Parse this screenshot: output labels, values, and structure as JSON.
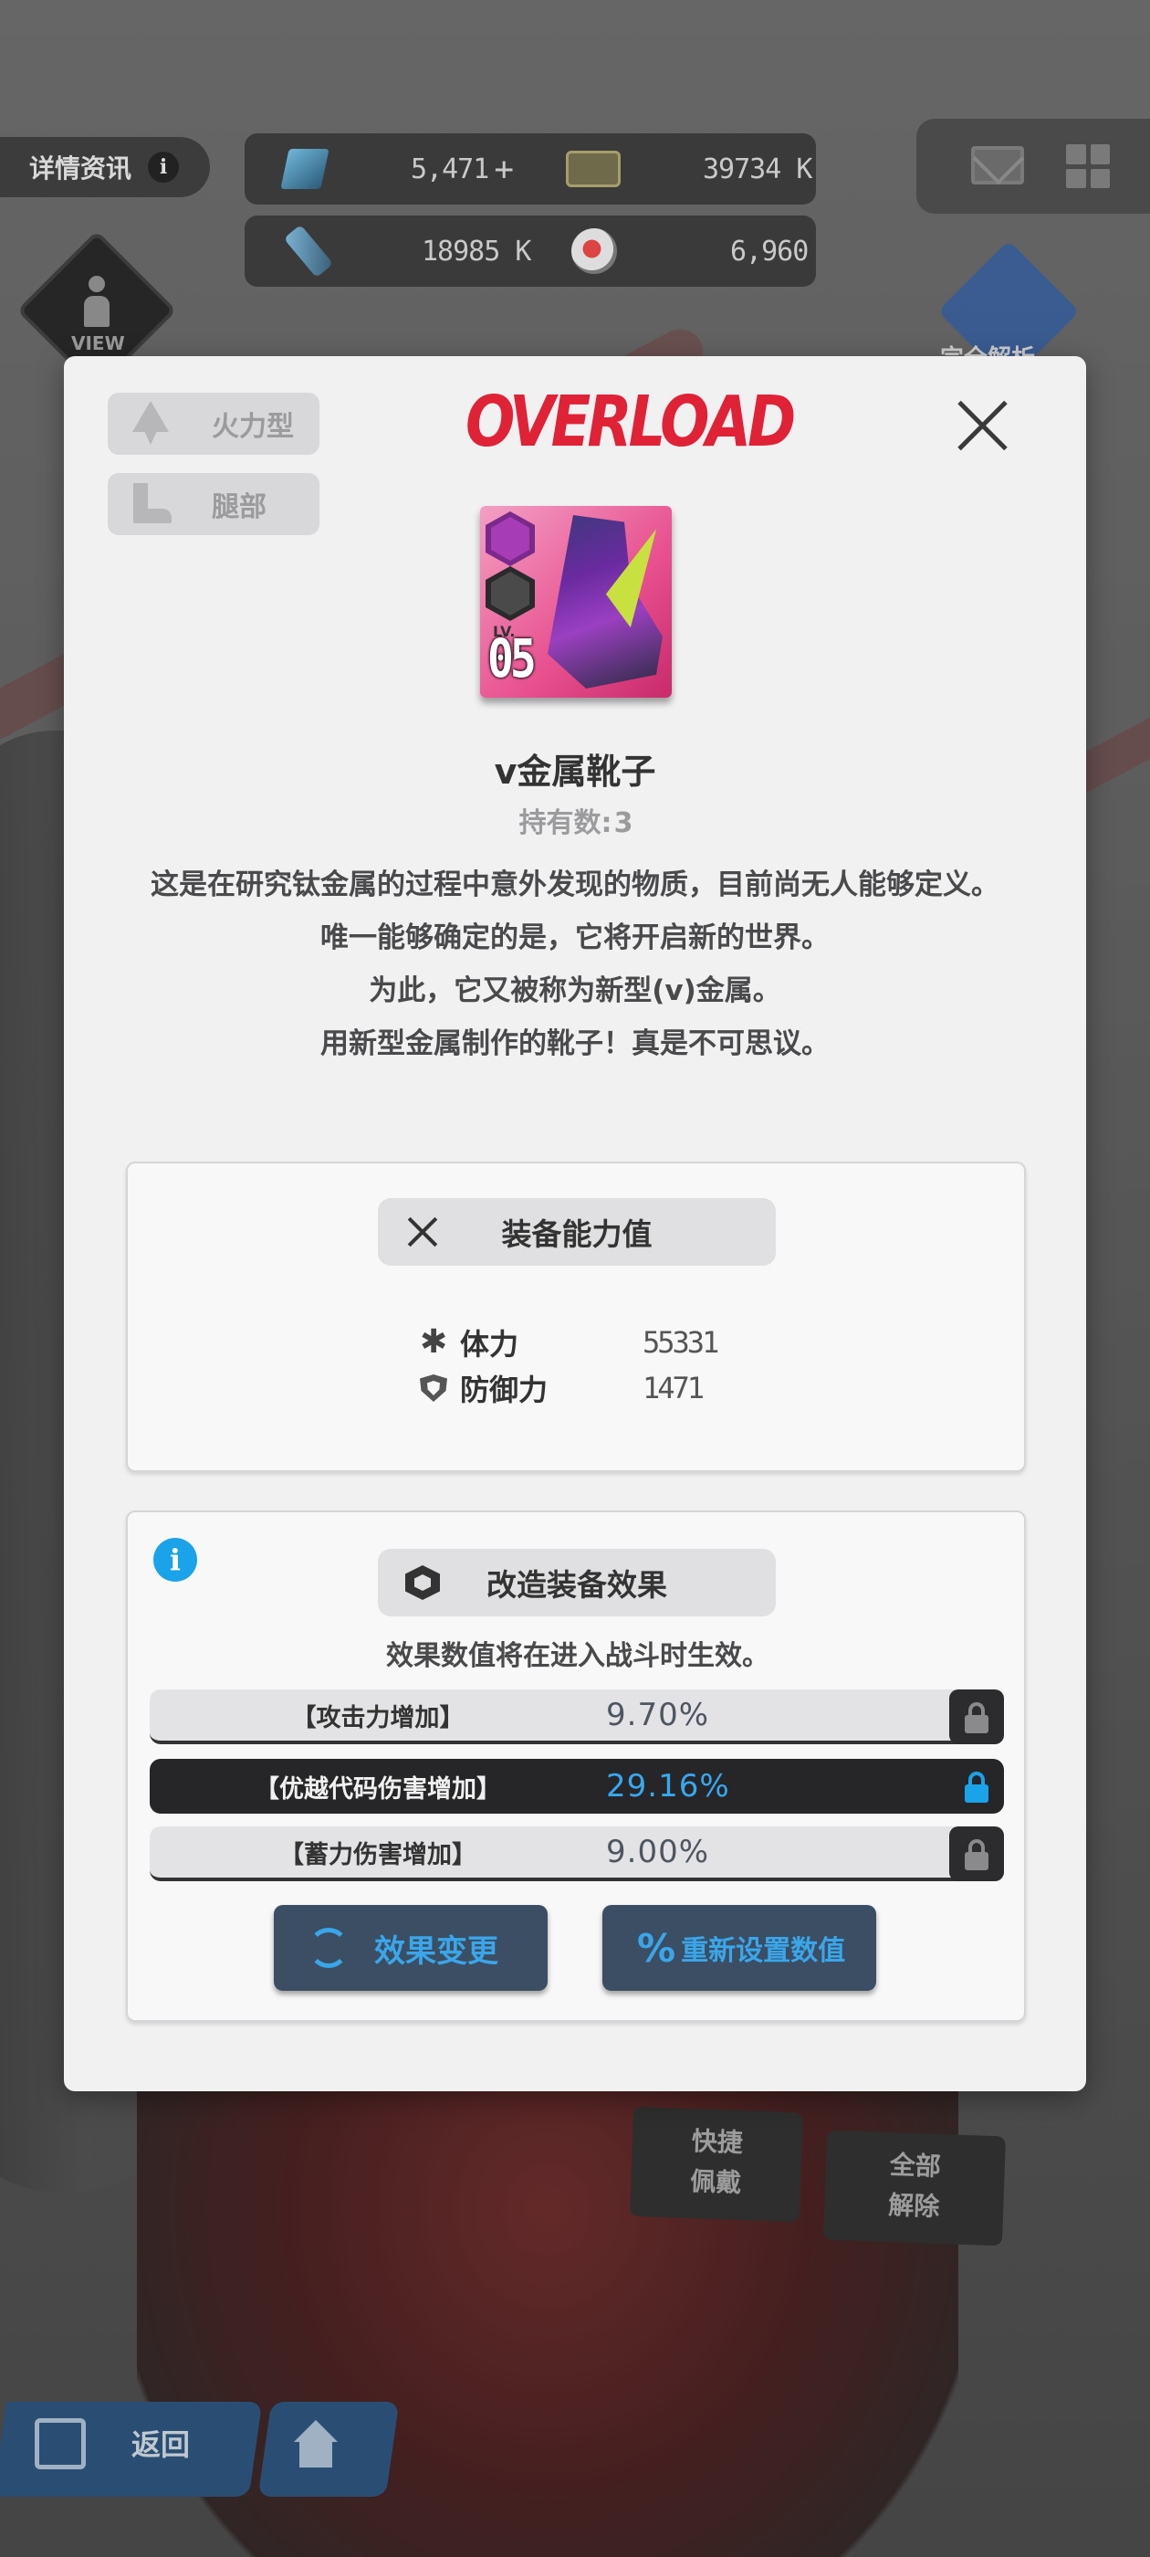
{
  "background": {
    "detail_tab_label": "详情资讯",
    "detail_info_glyph": "i",
    "resources": [
      {
        "icon": "gem-icon",
        "value": "5,471"
      },
      {
        "icon": "ticket-icon",
        "value": "39734 K"
      },
      {
        "icon": "core-icon",
        "value": "18985 K"
      },
      {
        "icon": "ball-icon",
        "value": "6,960"
      }
    ],
    "add_glyph": "+",
    "view_label": "VIEW",
    "star_label": "完全解析",
    "quick_equip_label": "快捷\n佩戴",
    "unequip_all_label": "全部\n解除",
    "back_label": "返回"
  },
  "modal": {
    "brand_logo_text": "OVERLOAD",
    "tags": [
      "火力型",
      "腿部"
    ],
    "item": {
      "level_prefix": "LV.",
      "level": "05",
      "name": "v金属靴子",
      "owned_label": "持有数:",
      "owned_count": "3",
      "description": [
        "这是在研究钛金属的过程中意外发现的物质，目前尚无人能够定义。",
        "唯一能够确定的是，它将开启新的世界。",
        "为此，它又被称为新型(v)金属。",
        "用新型金属制作的靴子！真是不可思议。"
      ]
    },
    "stats_panel": {
      "title": "装备能力值",
      "stats": [
        {
          "icon": "asterisk-icon",
          "name": "体力",
          "value": "55331"
        },
        {
          "icon": "shield-icon",
          "name": "防御力",
          "value": "1471"
        }
      ]
    },
    "effects_panel": {
      "title": "改造装备效果",
      "note": "效果数值将在进入战斗时生效。",
      "effects": [
        {
          "name": "【攻击力增加】",
          "value": "9.70%",
          "locked": false
        },
        {
          "name": "【优越代码伤害增加】",
          "value": "29.16%",
          "locked": true
        },
        {
          "name": "【蓄力伤害增加】",
          "value": "9.00%",
          "locked": false
        }
      ],
      "change_button": "效果变更",
      "reset_button": "重新设置数值"
    }
  },
  "colors": {
    "accent_blue": "#3aa6ea",
    "brand_red": "#e02236",
    "item_card_pink": "#e8508f"
  }
}
